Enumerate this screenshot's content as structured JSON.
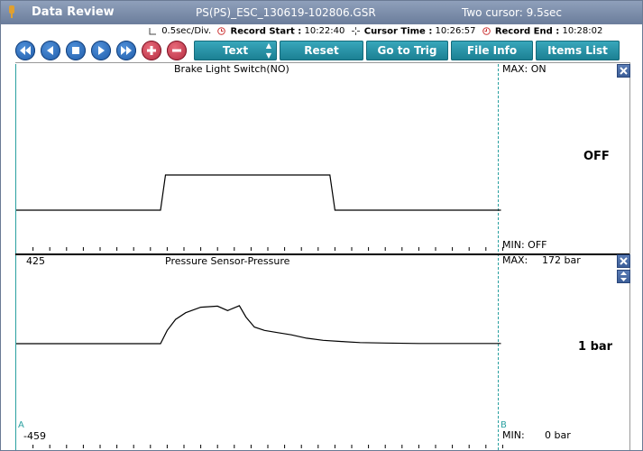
{
  "window": {
    "title": "Data Review",
    "file_name": "PS(PS)_ESC_130619-102806.GSR",
    "cursor_mode": "Two cursor: 9.5sec"
  },
  "info_bar": {
    "time_div": "0.5sec/Div.",
    "record_start_label": "Record Start :",
    "record_start": "10:22:40",
    "cursor_time_label": "Cursor Time :",
    "cursor_time": "10:26:57",
    "record_end_label": "Record End :",
    "record_end": "10:28:02"
  },
  "toolbar": {
    "buttons": [
      {
        "label": "Text",
        "icon": "updown-arrows-icon"
      },
      {
        "label": "Reset Min.Max"
      },
      {
        "label": "Go to Trig"
      },
      {
        "label": "File Info"
      },
      {
        "label": "Items List"
      }
    ],
    "nav_icons": [
      "rewind-icon",
      "step-back-icon",
      "stop-icon",
      "play-icon",
      "fast-forward-icon",
      "zoom-in-icon",
      "zoom-out-icon"
    ]
  },
  "panels": [
    {
      "title": "Brake Light Switch(NO)",
      "max": "MAX: ON",
      "min": "MIN: OFF",
      "current": "OFF",
      "y_top": "",
      "y_bottom": ""
    },
    {
      "title": "Pressure Sensor-Pressure",
      "max_label": "MAX:",
      "max": "172 bar",
      "min_label": "MIN:",
      "min": "0 bar",
      "current": "1 bar",
      "y_top": "425",
      "y_bottom": "-459"
    }
  ],
  "cursors": {
    "a": "A",
    "b": "B"
  },
  "colors": {
    "title_bar": "#7d8eab",
    "button": "#2a93a7",
    "nav_blue": "#2a6fc0",
    "nav_red": "#c83c50",
    "cursor_line": "#2aa0a0"
  },
  "chart_data": [
    {
      "type": "line",
      "title": "Brake Light Switch(NO)",
      "y_states": [
        "OFF",
        "ON"
      ],
      "x_divisions": 29,
      "x": [
        0,
        8.6,
        8.9,
        18.7,
        19.0,
        28.9
      ],
      "y": [
        0,
        0,
        1,
        1,
        0,
        0
      ]
    },
    {
      "type": "line",
      "title": "Pressure Sensor-Pressure",
      "ylim": [
        -459,
        425
      ],
      "x_divisions": 29,
      "x": [
        0,
        8.6,
        9.0,
        9.5,
        10.1,
        11.0,
        12.0,
        12.6,
        13.3,
        13.7,
        14.2,
        14.8,
        15.6,
        16.4,
        17.3,
        18.3,
        19.4,
        20.5,
        22.0,
        24.0,
        26.5,
        28.9
      ],
      "y": [
        0,
        0,
        60,
        110,
        140,
        165,
        170,
        150,
        172,
        120,
        75,
        60,
        50,
        40,
        25,
        15,
        10,
        5,
        3,
        1,
        1,
        1
      ]
    }
  ]
}
